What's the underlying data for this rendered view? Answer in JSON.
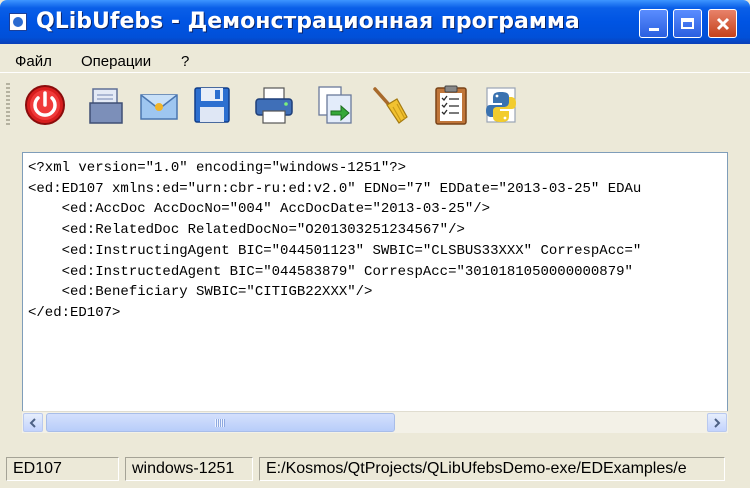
{
  "window": {
    "title": "QLibUfebs - Демонстрационная программа"
  },
  "menu": {
    "items": [
      {
        "label": "Файл"
      },
      {
        "label": "Операции"
      },
      {
        "label": "?"
      }
    ]
  },
  "toolbar": {
    "buttons": [
      {
        "icon": "power-icon"
      },
      {
        "icon": "open-document-icon"
      },
      {
        "icon": "envelope-icon"
      },
      {
        "icon": "floppy-save-icon"
      },
      {
        "icon": "printer-icon"
      },
      {
        "icon": "copy-forward-icon"
      },
      {
        "icon": "broom-clear-icon"
      },
      {
        "icon": "clipboard-checklist-icon"
      },
      {
        "icon": "python-icon"
      }
    ]
  },
  "editor": {
    "lines": [
      "<?xml version=\"1.0\" encoding=\"windows-1251\"?>",
      "<ed:ED107 xmlns:ed=\"urn:cbr-ru:ed:v2.0\" EDNo=\"7\" EDDate=\"2013-03-25\" EDAu",
      "    <ed:AccDoc AccDocNo=\"004\" AccDocDate=\"2013-03-25\"/>",
      "    <ed:RelatedDoc RelatedDocNo=\"O201303251234567\"/>",
      "    <ed:InstructingAgent BIC=\"044501123\" SWBIC=\"CLSBUS33XXX\" CorrespAcc=\"",
      "    <ed:InstructedAgent BIC=\"044583879\" CorrespAcc=\"3010181050000000879\"",
      "    <ed:Beneficiary SWBIC=\"CITIGB22XXX\"/>",
      "</ed:ED107>"
    ]
  },
  "statusbar": {
    "doc_type": "ED107",
    "encoding": "windows-1251",
    "path": "E:/Kosmos/QtProjects/QLibUfebsDemo-exe/EDExamples/e"
  }
}
